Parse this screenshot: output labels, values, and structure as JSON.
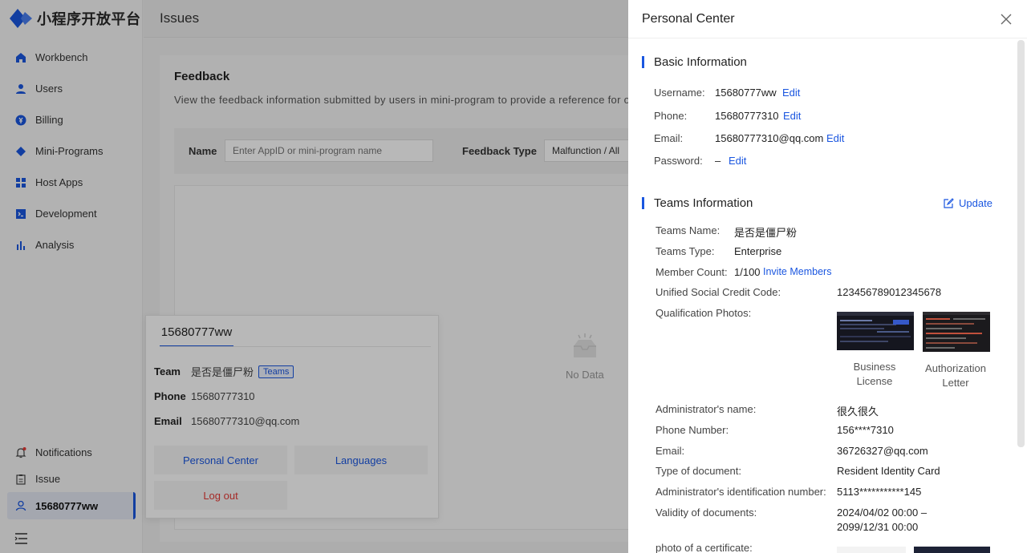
{
  "app": {
    "logo_text": "小程序开放平台",
    "page_title": "Issues"
  },
  "sidebar": {
    "items": [
      {
        "label": "Workbench",
        "icon": "home-icon"
      },
      {
        "label": "Users",
        "icon": "user-icon"
      },
      {
        "label": "Billing",
        "icon": "billing-icon"
      },
      {
        "label": "Mini-Programs",
        "icon": "mini-program-icon"
      },
      {
        "label": "Host Apps",
        "icon": "apps-grid-icon"
      },
      {
        "label": "Development",
        "icon": "terminal-icon"
      },
      {
        "label": "Analysis",
        "icon": "bar-chart-icon"
      }
    ],
    "bottom": {
      "notifications": "Notifications",
      "issue": "Issue",
      "account": "15680777ww"
    }
  },
  "feedback": {
    "title": "Feedback",
    "description": "View the feedback information submitted by users in mini-program to provide a reference for opt",
    "name_label": "Name",
    "name_placeholder": "Enter AppID or mini-program name",
    "type_label": "Feedback Type",
    "type_value": "Malfunction / All",
    "empty_text": "No Data"
  },
  "popover": {
    "tab": "15680777ww",
    "team_label": "Team",
    "team_value": "是否是僵尸粉",
    "team_tag": "Teams",
    "phone_label": "Phone",
    "phone_value": "15680777310",
    "email_label": "Email",
    "email_value": "15680777310@qq.com",
    "personal_center": "Personal Center",
    "languages": "Languages",
    "logout": "Log out"
  },
  "drawer": {
    "title": "Personal Center",
    "basic": {
      "title": "Basic Information",
      "username_label": "Username:",
      "username": "15680777ww",
      "phone_label": "Phone:",
      "phone": "15680777310",
      "email_label": "Email:",
      "email": "15680777310@qq.com",
      "password_label": "Password:",
      "password": "–",
      "edit": "Edit"
    },
    "teams": {
      "title": "Teams Information",
      "update": "Update",
      "name_label": "Teams Name:",
      "name": "是否是僵尸粉",
      "type_label": "Teams Type:",
      "type": "Enterprise",
      "count_label": "Member Count:",
      "count": "1/100",
      "invite": "Invite Members",
      "credit_label": "Unified Social Credit Code:",
      "credit": "123456789012345678",
      "photos_label": "Qualification Photos:",
      "license_caption": "Business License",
      "auth_caption": "Authorization Letter",
      "admin_name_label": "Administrator's name:",
      "admin_name": "很久很久",
      "admin_phone_label": "Phone Number:",
      "admin_phone": "156****7310",
      "admin_email_label": "Email:",
      "admin_email": "36726327@qq.com",
      "doc_type_label": "Type of document:",
      "doc_type": "Resident Identity Card",
      "id_label": "Administrator's identification number:",
      "id_number": "5113***********145",
      "validity_label": "Validity of documents:",
      "validity_line1": "2024/04/02 00:00 –",
      "validity_line2": "2099/12/31 00:00",
      "certificate_label": "photo of a certificate:"
    }
  },
  "colors": {
    "accent": "#1a56e0",
    "danger": "#e53935"
  }
}
